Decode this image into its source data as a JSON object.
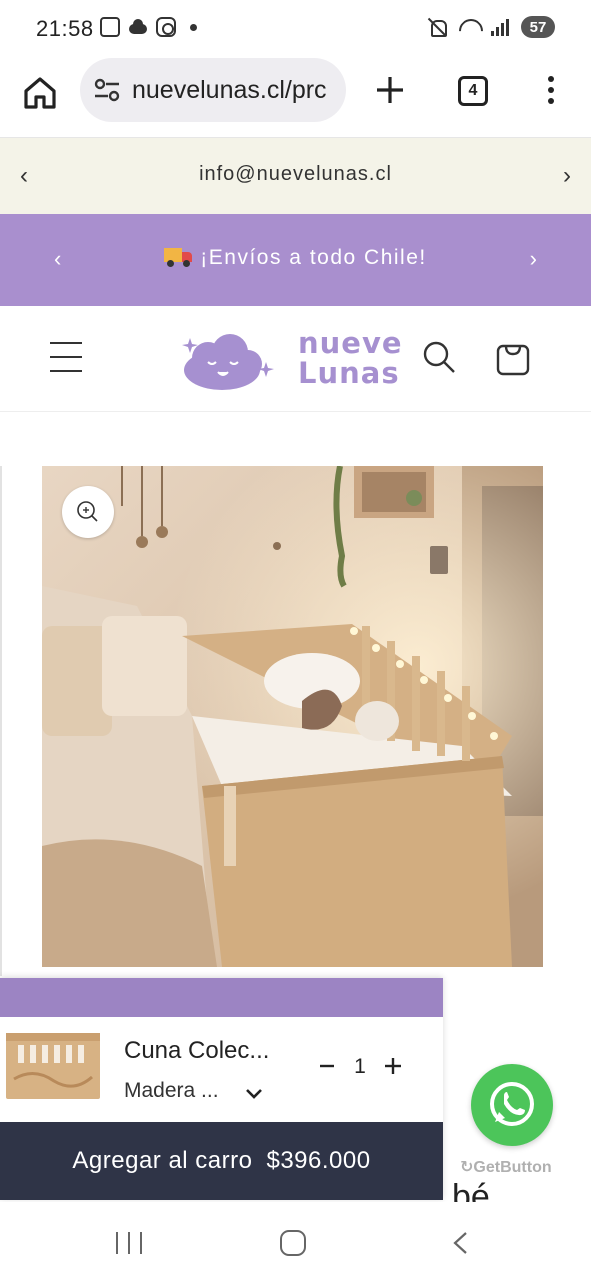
{
  "status": {
    "time": "21:58",
    "battery": "57"
  },
  "browser": {
    "url": "nuevelunas.cl/prc",
    "tab_count": "4"
  },
  "announcements": {
    "info": "info@nuevelunas.cl",
    "shipping": "¡Envíos a todo Chile!"
  },
  "header": {
    "logo_line1": "nueve",
    "logo_line2": "Lunas"
  },
  "sticky_cart": {
    "product_name": "Cuna Colec...",
    "variant": "Madera ...",
    "quantity": "1",
    "add_label": "Agregar al carro",
    "price": "$396.000"
  },
  "whatsapp": {
    "brand": "GetButton"
  },
  "partial_heading": "bé"
}
